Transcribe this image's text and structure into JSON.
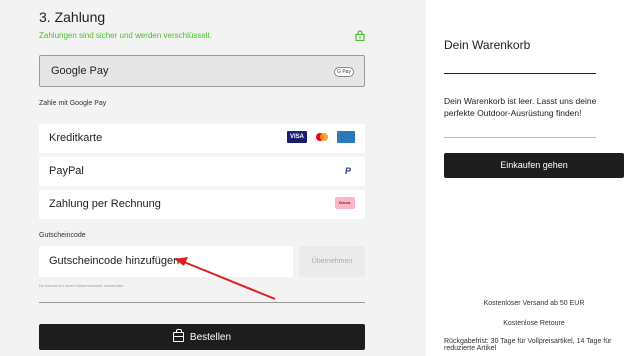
{
  "payment": {
    "title": "3. Zahlung",
    "secure_text": "Zahlungen sind sicher und werden verschlüsselt.",
    "google_pay_label": "Google Pay",
    "google_pay_badge": "G Pay",
    "pay_with_google_label": "Zahle mit Google Pay",
    "options": [
      {
        "label": "Kreditkarte",
        "icons": [
          "visa-icon",
          "mastercard-icon",
          "amex-icon"
        ]
      },
      {
        "label": "PayPal",
        "icons": [
          "paypal-icon"
        ]
      },
      {
        "label": "Zahlung per Rechnung",
        "icons": [
          "klarna-icon"
        ]
      }
    ],
    "visa_text": "VISA",
    "paypal_text": "P",
    "klarna_text": "Klarna."
  },
  "voucher": {
    "section_label": "Gutscheincode",
    "field_label": "Gutscheincode hinzufügen",
    "apply_label": "Übernehmen",
    "hint": "Du kannst nur einen Gutscheincode verwenden."
  },
  "order": {
    "button_label": "Bestellen"
  },
  "cart": {
    "title": "Dein Warenkorb",
    "empty_text": "Dein Warenkorb ist leer. Lasst uns deine perfekte Outdoor-Ausrüstung finden!",
    "shop_button": "Einkaufen gehen"
  },
  "info": {
    "shipping": "Kostenloser Versand ab 50 EUR",
    "returns": "Kostenlose Retoure",
    "return_period": "Rückgabefrist: 30 Tage für Vollpreisartikel, 14 Tage für reduzierte Artikel"
  },
  "colors": {
    "accent_red": "#d9302c",
    "secure_green": "#4bbf2f",
    "button_dark": "#1d1d1d"
  }
}
